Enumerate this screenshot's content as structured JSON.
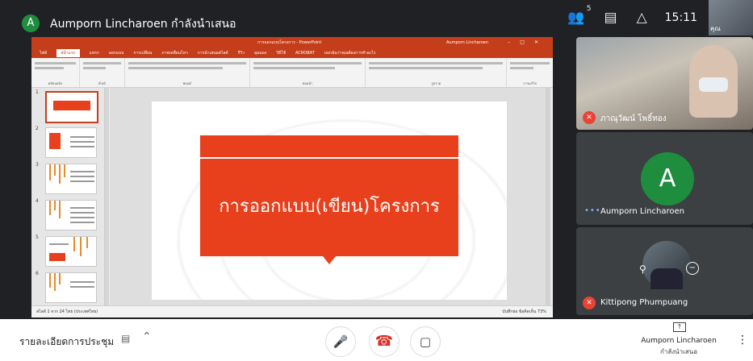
{
  "header": {
    "presenter_initial": "A",
    "presenting_title": "Aumporn Lincharoen กำลังนำเสนอ",
    "participant_count": "5",
    "time": "15:11",
    "self_label": "คุณ"
  },
  "powerpoint": {
    "window_title": "การออกแบบโครงการ - PowerPoint",
    "user": "Aumporn Lincharoen",
    "tabs": [
      "ไฟล์",
      "หน้าแรก",
      "แทรก",
      "ออกแบบ",
      "การเปลี่ยน",
      "ภาพเคลื่อนไหว",
      "การนำเสนอสไลด์",
      "รีวิว",
      "มุมมอง",
      "วิธีใช้",
      "ACROBAT",
      "บอกฉันว่าคุณต้องการทำอะไร"
    ],
    "ribbon_groups": [
      "คลิปบอร์ด",
      "สไลด์",
      "ฟอนต์",
      "ย่อหน้า",
      "รูปวาด",
      "การแก้ไข"
    ],
    "thumb_numbers": [
      "1",
      "2",
      "3",
      "4",
      "5",
      "6"
    ],
    "slide_title": "การออกแบบ(เขียน)โครงการ",
    "status_left": "สไลด์ 1 จาก 24   ไทย (ประเทศไทย)",
    "status_right": "บันทึกย่อ   ข้อคิดเห็น        73%"
  },
  "participants": [
    {
      "name": "ภาณุวัฒน์ โพธิ์ทอง",
      "muted": true
    },
    {
      "name": "Aumporn Lincharoen",
      "initial": "A"
    },
    {
      "name": "Kittipong Phumpuang",
      "muted": true
    }
  ],
  "bottom": {
    "meeting_details": "รายละเอียดการประชุม",
    "presenting_name": "Aumporn Lincharoen",
    "presenting_sub": "กำลังนำเสนอ"
  },
  "colors": {
    "ppt_accent": "#c43e1c",
    "slide_box": "#e8401c",
    "avatar_green": "#1e8e3e",
    "hangup_red": "#d93025"
  }
}
